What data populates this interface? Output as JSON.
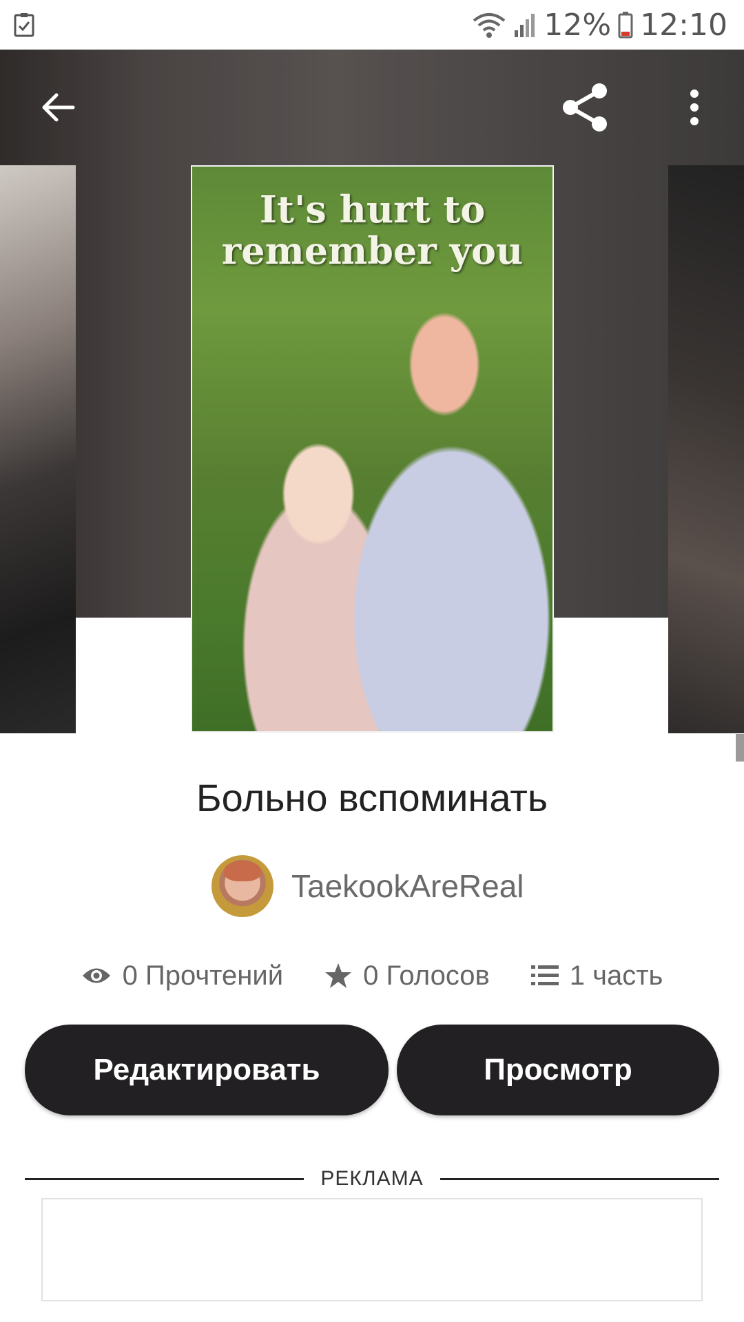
{
  "status_bar": {
    "battery_percent": "12%",
    "time": "12:10",
    "icons": [
      "task-check-icon",
      "wifi-icon",
      "signal-icon",
      "battery-low-icon"
    ]
  },
  "app_bar": {
    "icons": [
      "back-arrow-icon",
      "share-icon",
      "more-vert-icon"
    ]
  },
  "cover": {
    "title_text": "It's hurt to\nremember you"
  },
  "story": {
    "title": "Больно вспоминать",
    "author": "TaekookAreReal"
  },
  "stats": {
    "reads": "0 Прочтений",
    "votes": "0 Голосов",
    "parts": "1 часть"
  },
  "actions": {
    "edit_label": "Редактировать",
    "view_label": "Просмотр"
  },
  "ad": {
    "label": "РЕКЛАМА"
  },
  "colors": {
    "button_bg": "#222022",
    "button_text": "#ffffff",
    "author_text": "#6a6a6a",
    "stats_text": "#666666"
  }
}
